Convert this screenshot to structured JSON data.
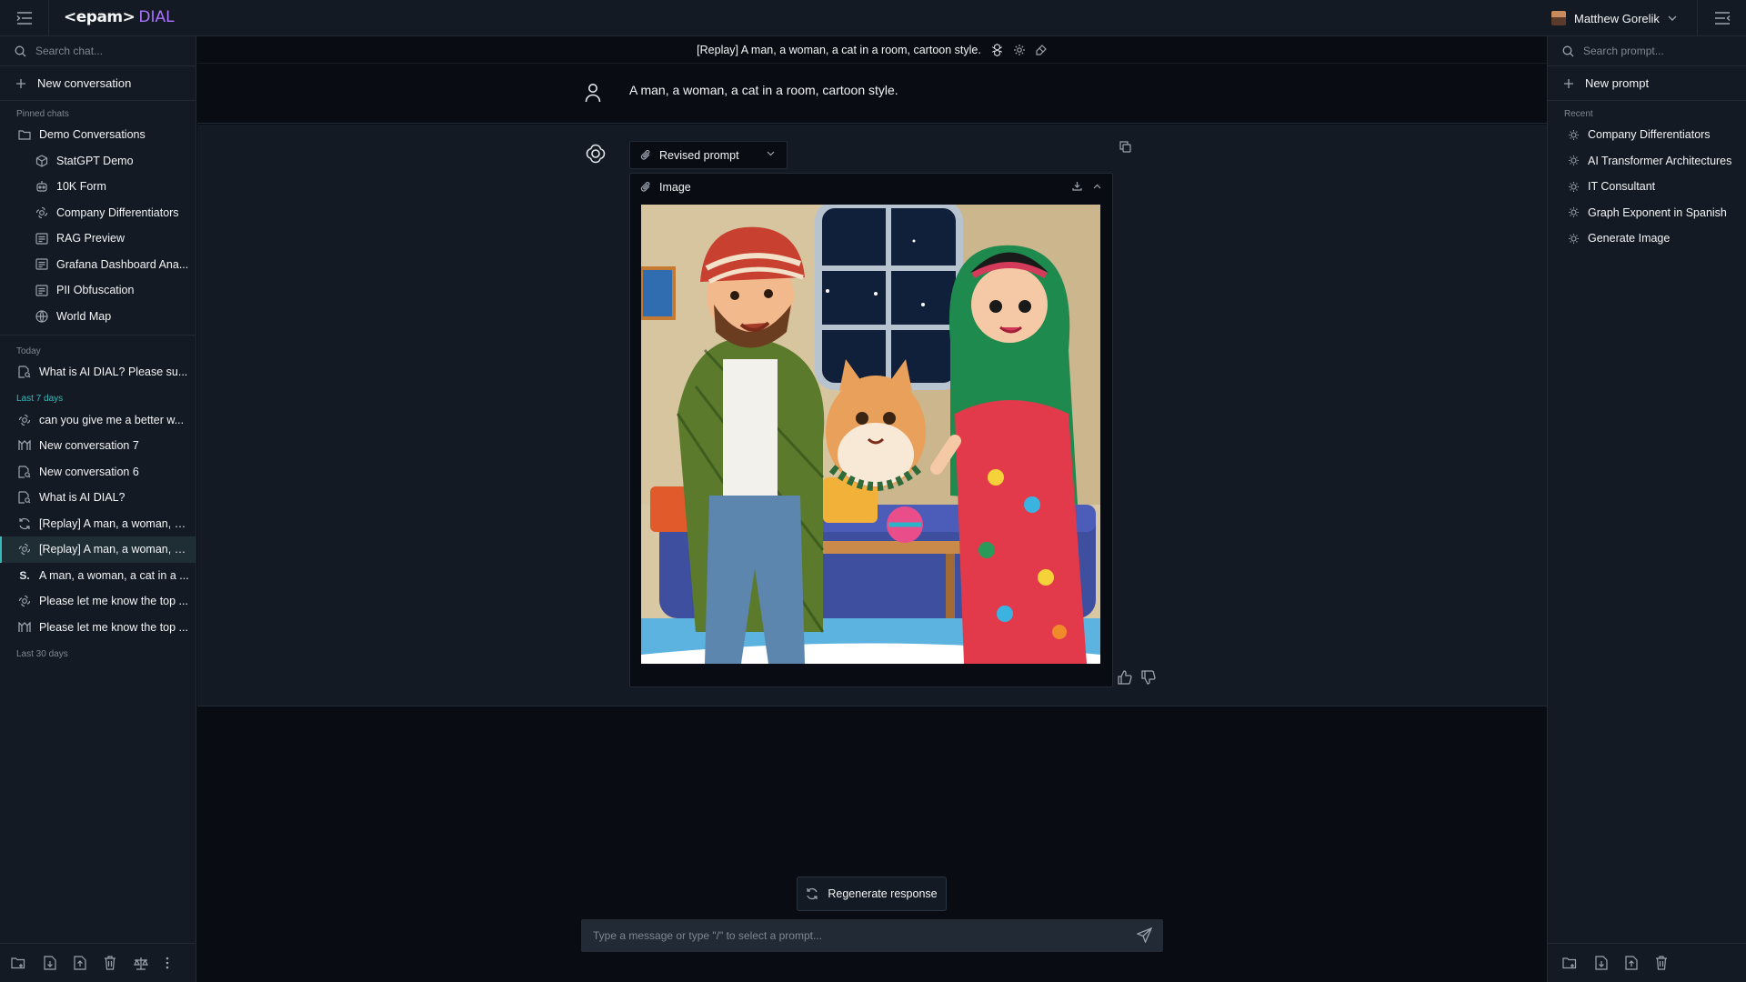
{
  "app": {
    "logo_brand": "<epam>",
    "logo_product": "DIAL",
    "accent_color": "#a972ff",
    "teal_color": "#37babc"
  },
  "header": {
    "user_name": "Matthew Gorelik"
  },
  "left_sidebar": {
    "search_placeholder": "Search chat...",
    "new_conversation": "New conversation",
    "pinned_label": "Pinned chats",
    "folder": {
      "label": "Demo Conversations",
      "icon": "folder-icon"
    },
    "pinned_items": [
      {
        "label": "StatGPT Demo",
        "icon": "cube-icon"
      },
      {
        "label": "10K Form",
        "icon": "robot-icon"
      },
      {
        "label": "Company Differentiators",
        "icon": "openai-icon"
      },
      {
        "label": "RAG Preview",
        "icon": "message-icon"
      },
      {
        "label": "Grafana Dashboard Ana...",
        "icon": "message-icon"
      },
      {
        "label": "PII Obfuscation",
        "icon": "message-icon"
      },
      {
        "label": "World Map",
        "icon": "globe-icon"
      }
    ],
    "today_label": "Today",
    "today_items": [
      {
        "label": "What is AI DIAL? Please su...",
        "icon": "doc-search-icon"
      }
    ],
    "last7_label": "Last 7 days",
    "last7_items": [
      {
        "label": "can you give me a better w...",
        "icon": "openai-icon"
      },
      {
        "label": "New conversation 7",
        "icon": "mistral-icon"
      },
      {
        "label": "New conversation 6",
        "icon": "doc-search-icon"
      },
      {
        "label": "What is AI DIAL?",
        "icon": "doc-search-icon"
      },
      {
        "label": "[Replay] A man, a woman, a...",
        "icon": "replay-icon"
      },
      {
        "label": "[Replay] A man, a woman, a...",
        "icon": "openai-icon"
      },
      {
        "label": "A man, a woman, a cat in a ...",
        "icon": "stability-icon",
        "icon_text": "S."
      },
      {
        "label": "Please let me know the top ...",
        "icon": "openai-icon"
      },
      {
        "label": "Please let me know the top ...",
        "icon": "mistral-icon"
      }
    ],
    "last30_label": "Last 30 days"
  },
  "chat": {
    "title": "[Replay] A man, a woman, a cat in a room, cartoon style.",
    "user_message": "A man, a woman, a cat in a room, cartoon style.",
    "stage_revised_label": "Revised prompt",
    "stage_image_label": "Image",
    "regenerate_label": "Regenerate response",
    "composer_placeholder": "Type a message or type \"/\" to select a prompt..."
  },
  "right_sidebar": {
    "search_placeholder": "Search prompt...",
    "new_prompt": "New prompt",
    "recent_label": "Recent",
    "prompts": [
      "Company Differentiators",
      "AI Transformer Architectures",
      "IT Consultant",
      "Graph Exponent in Spanish",
      "Generate Image"
    ]
  }
}
